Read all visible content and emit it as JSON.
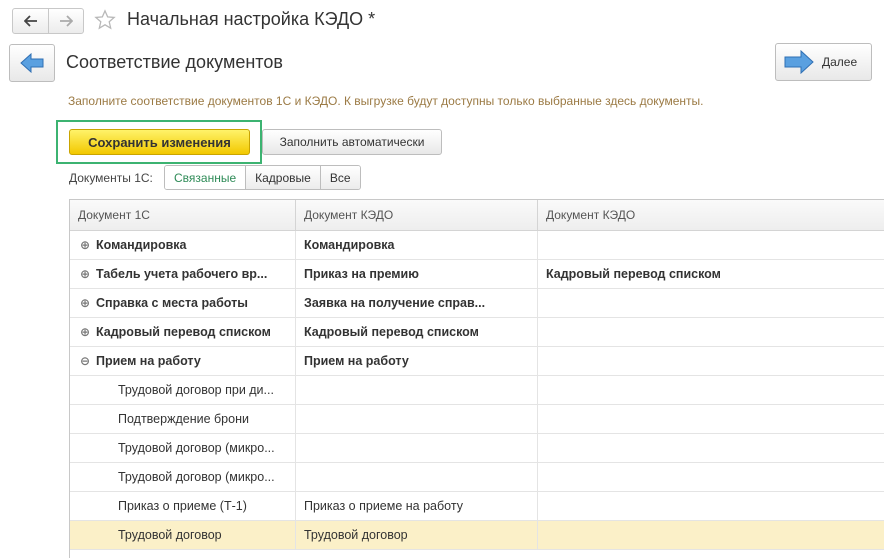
{
  "window": {
    "title": "Начальная настройка КЭДО *",
    "back_icon": "arrow-left-icon",
    "forward_icon": "arrow-right-icon",
    "favorite_icon": "star-icon"
  },
  "form": {
    "title": "Соответствие документов",
    "next_label": "Далее",
    "hint": "Заполните соответствие документов 1С и КЭДО. К выгрузке будут доступны только выбранные здесь документы."
  },
  "toolbar": {
    "save_label": "Сохранить изменения",
    "autofill_label": "Заполнить автоматически"
  },
  "filter": {
    "label": "Документы 1С:",
    "options": [
      "Связанные",
      "Кадровые",
      "Все"
    ],
    "selected": "Связанные"
  },
  "table": {
    "columns": [
      "Документ 1С",
      "Документ КЭДО",
      "Документ КЭДО"
    ],
    "rows": [
      {
        "toggle": "⊕",
        "c1": "Командировка",
        "c2": "Командировка",
        "c3": ""
      },
      {
        "toggle": "⊕",
        "c1": "Табель учета рабочего вр...",
        "c2": "Приказ на премию",
        "c3": "Кадровый перевод списком"
      },
      {
        "toggle": "⊕",
        "c1": "Справка с места работы",
        "c2": "Заявка на получение справ...",
        "c3": ""
      },
      {
        "toggle": "⊕",
        "c1": "Кадровый перевод списком",
        "c2": "Кадровый перевод списком",
        "c3": ""
      },
      {
        "toggle": "⊖",
        "c1": "Прием на работу",
        "c2": "Прием на работу",
        "c3": ""
      },
      {
        "c1": "Трудовой договор при ди...",
        "c2": "",
        "c3": ""
      },
      {
        "c1": "Подтверждение брони",
        "c2": "",
        "c3": ""
      },
      {
        "c1": "Трудовой договор (микро...",
        "c2": "",
        "c3": ""
      },
      {
        "c1": "Трудовой договор (микро...",
        "c2": "",
        "c3": ""
      },
      {
        "c1": "Приказ о приеме (Т-1)",
        "c2": "Приказ о приеме на работу",
        "c3": ""
      },
      {
        "c1": "Трудовой договор",
        "c2": "Трудовой договор",
        "c3": ""
      }
    ]
  },
  "colors": {
    "save_button": "#f5d414",
    "highlight_box": "#3cb371",
    "hint_text": "#9b7a44",
    "selected_row": "#fbf0c8",
    "active_filter": "#2e8b57",
    "next_arrow": "#4a90d9"
  }
}
